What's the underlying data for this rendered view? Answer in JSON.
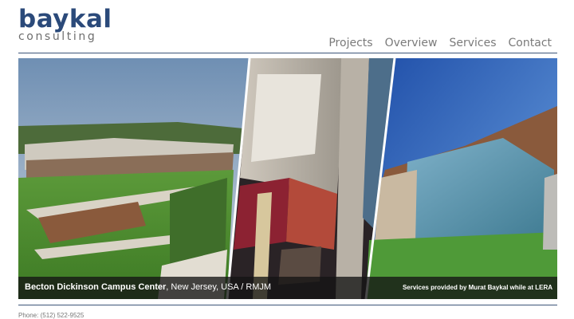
{
  "logo": {
    "main": "baykal",
    "sub": "consulting"
  },
  "nav": [
    "Projects",
    "Overview",
    "Services",
    "Contact"
  ],
  "hero": {
    "project_name": "Becton Dickinson Campus Center",
    "location": ", New Jersey, USA  /  RMJM",
    "credit": "Services provided by Murat Baykal while at LERA"
  },
  "footer": {
    "phone": "Phone: (512) 522-9525"
  },
  "colors": {
    "brand": "#2b4a7a",
    "rule": "#3b5478",
    "nav_text": "#7a7a7a"
  }
}
